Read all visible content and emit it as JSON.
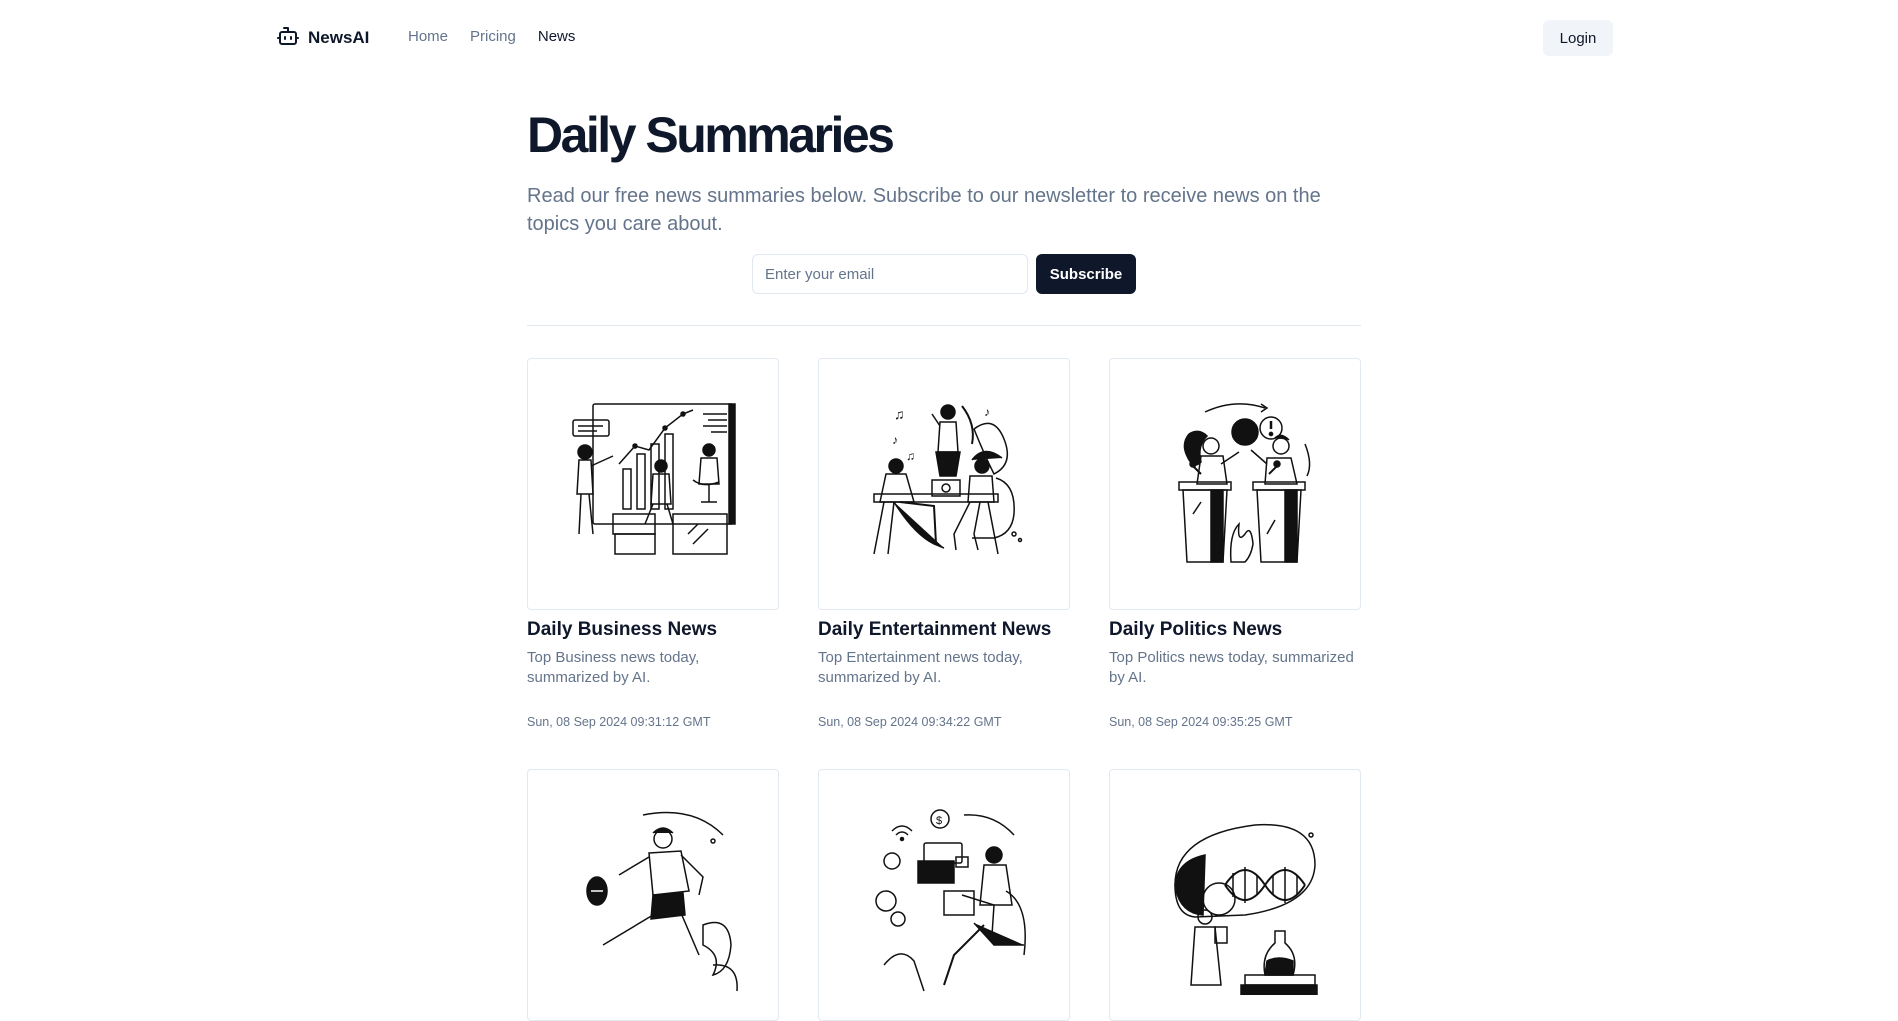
{
  "nav": {
    "brand": "NewsAI",
    "links": [
      {
        "label": "Home"
      },
      {
        "label": "Pricing"
      },
      {
        "label": "News"
      }
    ],
    "login_label": "Login"
  },
  "hero": {
    "title": "Daily Summaries",
    "subtitle": "Read our free news summaries below. Subscribe to our newsletter to receive news on the topics you care about.",
    "email_placeholder": "Enter your email",
    "subscribe_label": "Subscribe"
  },
  "cards": [
    {
      "title": "Daily Business News",
      "description": "Top Business news today, summarized by AI.",
      "date": "Sun, 08 Sep 2024 09:31:12 GMT",
      "illustration": "business-presentation-illustration"
    },
    {
      "title": "Daily Entertainment News",
      "description": "Top Entertainment news today, summarized by AI.",
      "date": "Sun, 08 Sep 2024 09:34:22 GMT",
      "illustration": "entertainment-music-illustration"
    },
    {
      "title": "Daily Politics News",
      "description": "Top Politics news today, summarized by AI.",
      "date": "Sun, 08 Sep 2024 09:35:25 GMT",
      "illustration": "politics-debate-illustration"
    },
    {
      "illustration": "sports-football-illustration"
    },
    {
      "illustration": "technology-laptop-illustration"
    },
    {
      "illustration": "science-dna-illustration"
    }
  ],
  "colors": {
    "primary": "#0f172a",
    "muted_text": "#64748b",
    "border": "#e2e8f0",
    "secondary_bg": "#f1f5f9"
  }
}
